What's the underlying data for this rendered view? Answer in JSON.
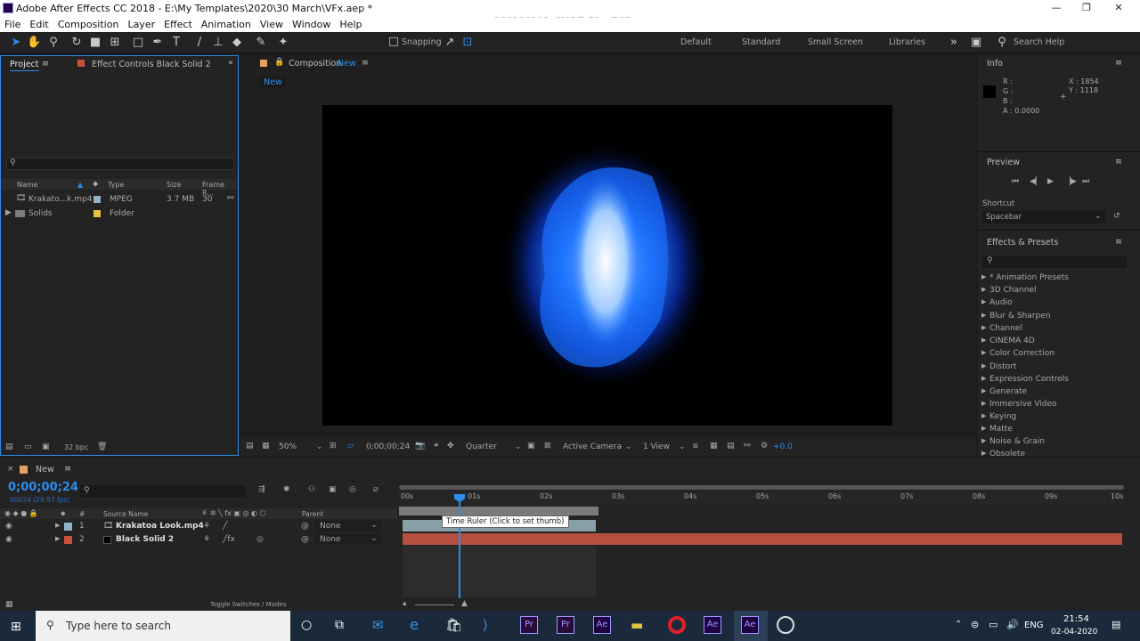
{
  "window": {
    "title": "Adobe After Effects CC 2018 - E:\\My Templates\\2020\\30 March\\VFx.aep *"
  },
  "menu": [
    "File",
    "Edit",
    "Composition",
    "Layer",
    "Effect",
    "Animation",
    "View",
    "Window",
    "Help"
  ],
  "watermark": "www.rrcg.cn",
  "toolbar": {
    "snapping": "Snapping",
    "workspaces": [
      "Default",
      "Standard",
      "Small Screen",
      "Libraries"
    ],
    "search_help": "Search Help"
  },
  "project": {
    "tab": "Project",
    "effect_controls": "Effect Controls Black Solid 2",
    "columns": [
      "Name",
      "Type",
      "Size",
      "Frame R..."
    ],
    "items": [
      {
        "name": "Krakato...k.mp4",
        "type": "MPEG",
        "size": "3.7 MB",
        "fps": "30"
      },
      {
        "name": "Solids",
        "type": "Folder",
        "size": "",
        "fps": ""
      }
    ],
    "bpc": "32 bpc"
  },
  "composition": {
    "tab_prefix": "Composition",
    "tab_name": "New",
    "sub_tab": "New",
    "zoom": "50%",
    "time": "0;00;00;24",
    "resolution": "Quarter",
    "camera": "Active Camera",
    "view": "1 View",
    "exposure": "+0.0"
  },
  "info": {
    "title": "Info",
    "r": "R :",
    "g": "G :",
    "b": "B :",
    "a": "A : 0.0000",
    "x": "X : 1854",
    "y": "Y : 1118"
  },
  "preview": {
    "title": "Preview",
    "shortcut_label": "Shortcut",
    "shortcut": "Spacebar"
  },
  "effects": {
    "title": "Effects & Presets",
    "items": [
      "* Animation Presets",
      "3D Channel",
      "Audio",
      "Blur & Sharpen",
      "Channel",
      "CINEMA 4D",
      "Color Correction",
      "Distort",
      "Expression Controls",
      "Generate",
      "Immersive Video",
      "Keying",
      "Matte",
      "Noise & Grain",
      "Obsolete"
    ]
  },
  "timeline": {
    "tab": "New",
    "timecode": "0;00;00;24",
    "frames": "00024 (29.97 fps)",
    "col_source": "Source Name",
    "col_parent": "Parent",
    "col_num": "#",
    "ruler": [
      "00s",
      "01s",
      "02s",
      "03s",
      "04s",
      "05s",
      "06s",
      "07s",
      "08s",
      "09s",
      "10s"
    ],
    "layers": [
      {
        "num": "1",
        "name": "Krakatoa Look.mp4",
        "parent": "None",
        "color": "#8fb4c8"
      },
      {
        "num": "2",
        "name": "Black Solid 2",
        "parent": "None",
        "color": "#c8503c"
      }
    ],
    "tooltip": "Time Ruler (Click to set thumb)",
    "toggle": "Toggle Switches / Modes"
  },
  "taskbar": {
    "search": "Type here to search",
    "lang": "ENG",
    "time": "21:54",
    "date": "02-04-2020"
  }
}
